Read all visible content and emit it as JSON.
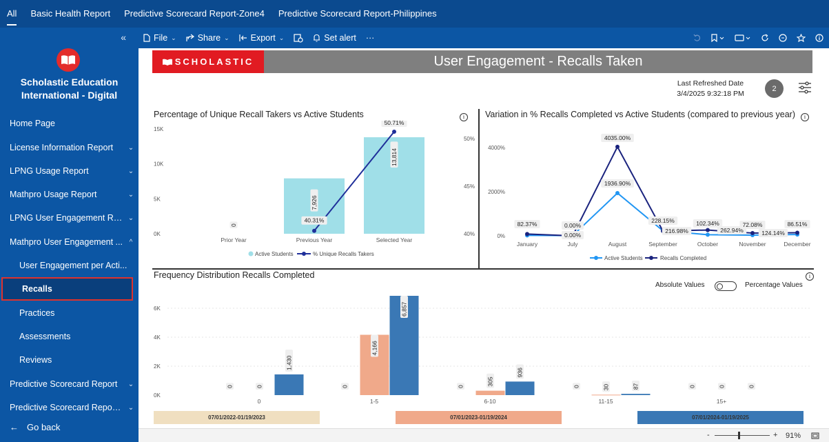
{
  "top_tabs": [
    "All",
    "Basic Health Report",
    "Predictive Scorecard Report-Zone4",
    "Predictive Scorecard Report-Philippines"
  ],
  "sidebar": {
    "collapse_icon": "«",
    "brand": [
      "Scholastic Education",
      "International - Digital"
    ],
    "items": [
      {
        "label": "Home Page",
        "chev": ""
      },
      {
        "label": "License Information Report",
        "chev": "⌄"
      },
      {
        "label": "LPNG Usage Report",
        "chev": "⌄"
      },
      {
        "label": "Mathpro Usage Report",
        "chev": "⌄"
      },
      {
        "label": "LPNG User Engagement Rep...",
        "chev": "⌄"
      },
      {
        "label": "Mathpro User Engagement ...",
        "chev": "^"
      },
      {
        "label": "User Engagement per Acti...",
        "chev": ""
      },
      {
        "label": "Recalls",
        "chev": ""
      },
      {
        "label": "Practices",
        "chev": ""
      },
      {
        "label": "Assessments",
        "chev": ""
      },
      {
        "label": "Reviews",
        "chev": ""
      },
      {
        "label": "Predictive Scorecard Report",
        "chev": "⌄"
      },
      {
        "label": "Predictive Scorecard Report-...",
        "chev": "⌄"
      }
    ],
    "go_back": "Go back",
    "go_back_arrow": "←"
  },
  "toolbar": {
    "file": "File",
    "share": "Share",
    "export": "Export",
    "set_alert": "Set alert",
    "more": "···",
    "chev": "⌄"
  },
  "report": {
    "logo_text": "SCHOLASTIC",
    "title": "User Engagement - Recalls Taken",
    "refresh_label": "Last Refreshed Date",
    "refresh_value": "3/4/2025 9:32:18 PM",
    "badge": "2",
    "info_glyph": "i"
  },
  "colors": {
    "topbar": "#0b4a8f",
    "sidebar": "#0c56a4",
    "active_students": "#a0dfe8",
    "unique_line": "#1f2f9a",
    "light_blue": "#2196f3",
    "dark_blue": "#1a237e",
    "salmon": "#f0a98a",
    "tan": "#f0dfc0",
    "steel_blue": "#3a78b5"
  },
  "chart_data": [
    {
      "type": "bar",
      "title": "Percentage of Unique Recall Takers vs Active Students",
      "categories": [
        "Prior Year",
        "Previous Year",
        "Selected Year"
      ],
      "y_ticks": [
        "0K",
        "5K",
        "10K",
        "15K"
      ],
      "y2_ticks": [
        "40%",
        "45%",
        "50%"
      ],
      "ylim": [
        0,
        15000
      ],
      "y2lim": [
        40,
        51
      ],
      "series": [
        {
          "name": "Active Students",
          "type": "bar",
          "values": [
            0,
            7926,
            13814
          ],
          "labels": [
            "0",
            "7,926",
            "13,814"
          ]
        },
        {
          "name": "% Unique Recalls Takers",
          "type": "line",
          "values": [
            null,
            40.31,
            50.71
          ],
          "labels": [
            "",
            "40.31%",
            "50.71%"
          ]
        }
      ],
      "legend": "bottom"
    },
    {
      "type": "line",
      "title": "Variation in % Recalls Completed vs Active Students (compared to previous year)",
      "categories": [
        "January",
        "July",
        "August",
        "September",
        "October",
        "November",
        "December"
      ],
      "y_ticks": [
        "0%",
        "2000%",
        "4000%"
      ],
      "ylim": [
        -50,
        4150
      ],
      "series": [
        {
          "name": "Active Students",
          "values": [
            20,
            10,
            1936.9,
            228.15,
            50,
            30,
            60
          ],
          "labels": [
            "",
            "0.00%",
            "1936.90%",
            "228.15%",
            "",
            "72.08%",
            "86.51%"
          ]
        },
        {
          "name": "Recalls Completed",
          "values": [
            82.37,
            0,
            4035,
            216.98,
            262.94,
            124.14,
            140
          ],
          "labels": [
            "82.37%",
            "0.00%",
            "4035.00%",
            "216.98%",
            "102.34%",
            "124.14%",
            ""
          ]
        }
      ],
      "extra_label": "262.94%",
      "legend": "bottom"
    },
    {
      "type": "bar",
      "title": "Frequency Distribution Recalls Completed",
      "categories": [
        "0",
        "1-5",
        "6-10",
        "11-15",
        "15+"
      ],
      "y_ticks": [
        "0K",
        "2K",
        "4K",
        "6K"
      ],
      "ylim": [
        0,
        7000
      ],
      "series": [
        {
          "name": "07/01/2022-01/19/2023",
          "values": [
            0,
            0,
            0,
            0,
            0
          ]
        },
        {
          "name": "07/01/2023-01/19/2024",
          "values": [
            0,
            4166,
            305,
            30,
            0
          ]
        },
        {
          "name": "07/01/2024-01/19/2025",
          "values": [
            1430,
            6857,
            936,
            87,
            0
          ]
        }
      ],
      "labels": [
        [
          "0",
          "0",
          "1,430"
        ],
        [
          "0",
          "4,166",
          "6,857"
        ],
        [
          "0",
          "305",
          "936"
        ],
        [
          "0",
          "30",
          "87"
        ],
        [
          "0",
          "0",
          "0"
        ]
      ],
      "toggle_left": "Absolute Values",
      "toggle_right": "Percentage Values",
      "legend": "bottom"
    }
  ],
  "status": {
    "zoom_minus": "-",
    "zoom_plus": "+",
    "zoom": "91%"
  }
}
